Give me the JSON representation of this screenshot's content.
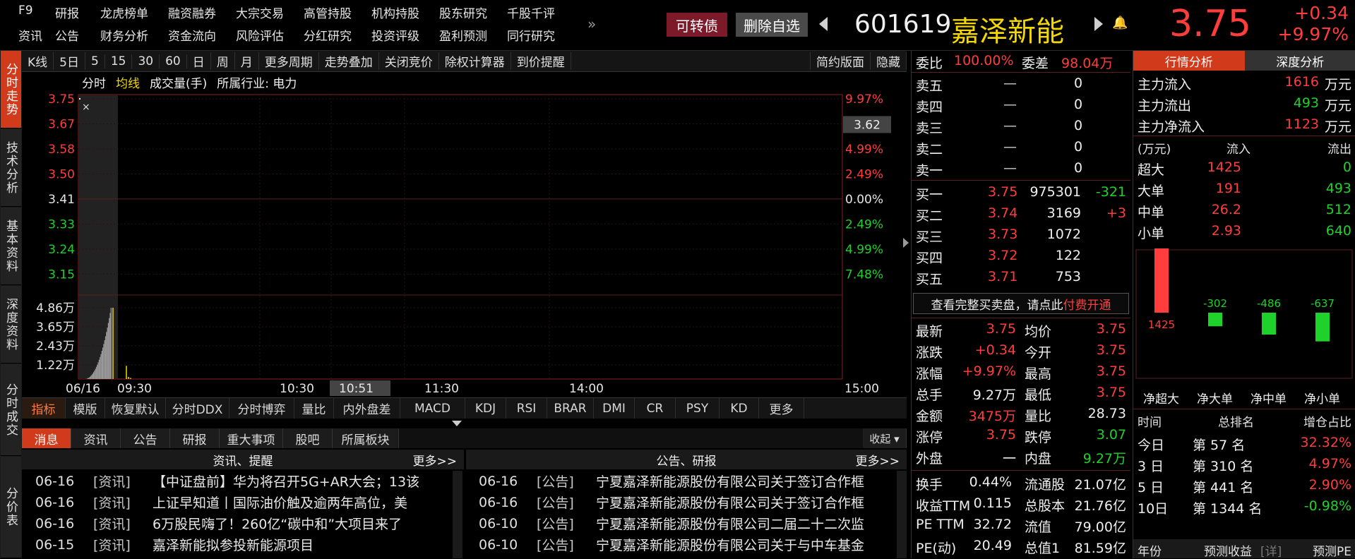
{
  "header": {
    "row1": [
      "F9",
      "研报",
      "龙虎榜单",
      "融资融券",
      "大宗交易",
      "高管持股",
      "机构持股",
      "股东研究",
      "千股千评"
    ],
    "row2": [
      "资讯",
      "公告",
      "财务分析",
      "资金流向",
      "风险评估",
      "分红研究",
      "投资评级",
      "盈利预测",
      "同行研究"
    ],
    "expand_glyph": "»",
    "convertible_btn": "可转债",
    "remove_fav_btn": "删除自选",
    "code": "601619",
    "name": "嘉泽新能",
    "price": "3.75",
    "change": "+0.34",
    "change_pct": "+9.97%"
  },
  "left_tabs": [
    "分时走势",
    "技术分析",
    "基本资料",
    "深度资料",
    "分时成交",
    "分价表"
  ],
  "chart_toolbar": {
    "items": [
      "K线",
      "5日",
      "5",
      "15",
      "30",
      "60",
      "日",
      "周",
      "月",
      "更多周期",
      "走势叠加",
      "关闭竞价",
      "除权计算器",
      "到价提醒"
    ],
    "simple_layout": "简约版面",
    "hide": "隐藏"
  },
  "chart_legend": {
    "fenshi": "分时",
    "junxian": "均线",
    "volume": "成交量(手)",
    "industry": "所属行业: 电力"
  },
  "chart_data": {
    "type": "line",
    "prev_close": 3.41,
    "price_ticks": [
      "3.75",
      "3.67",
      "3.58",
      "3.50",
      "3.41",
      "3.33",
      "3.24",
      "3.15"
    ],
    "pct_ticks": [
      "9.97%",
      "7.48%",
      "4.99%",
      "2.49%",
      "0.00%",
      "2.49%",
      "4.99%",
      "7.48%"
    ],
    "hover_price": "3.62",
    "vol_ticks": [
      "4.86万",
      "3.65万",
      "2.43万",
      "1.22万"
    ],
    "time_ticks": [
      "06/16",
      "09:30",
      "10:30",
      "10:51",
      "11:30",
      "14:00",
      "15:00"
    ],
    "price_series": [
      {
        "t": "09:30",
        "v": 3.75
      },
      {
        "t": "09:32",
        "v": 3.75
      }
    ],
    "volume_series": [
      {
        "t": "09:30",
        "v": 48600
      },
      {
        "t": "09:31",
        "v": 9000
      },
      {
        "t": "09:33",
        "v": 1500
      },
      {
        "t": "09:35",
        "v": 800
      }
    ]
  },
  "indicator_tabs": [
    "指标",
    "模版",
    "恢复默认",
    "分时DDX",
    "分时博弈",
    "量比",
    "内外盘差",
    "MACD",
    "KDJ",
    "RSI",
    "BRAR",
    "DMI",
    "CR",
    "PSY",
    "KD",
    "更多"
  ],
  "news_tabs": [
    "消息",
    "资讯",
    "公告",
    "研报",
    "重大事项",
    "股吧",
    "所属板块"
  ],
  "news_collapse": "收起",
  "news_left": {
    "title": "资讯、提醒",
    "more": "更多>>",
    "rows": [
      {
        "d": "06-16",
        "t": "[资讯]",
        "s": "【中证盘前】华为将召开5G+AR大会；13该"
      },
      {
        "d": "06-16",
        "t": "[资讯]",
        "s": "上证早知道丨国际油价触及逾两年高位，美"
      },
      {
        "d": "06-16",
        "t": "[资讯]",
        "s": "6万股民嗨了！260亿“碳中和”大项目来了"
      },
      {
        "d": "06-15",
        "t": "[资讯]",
        "s": "嘉泽新能拟参投新能源项目"
      }
    ]
  },
  "news_right": {
    "title": "公告、研报",
    "more": "更多>>",
    "rows": [
      {
        "d": "06-16",
        "t": "[公告]",
        "s": "宁夏嘉泽新能源股份有限公司关于签订合作框"
      },
      {
        "d": "06-16",
        "t": "[公告]",
        "s": "宁夏嘉泽新能源股份有限公司关于签订合作框"
      },
      {
        "d": "06-10",
        "t": "[公告]",
        "s": "宁夏嘉泽新能源股份有限公司二届二十二次监"
      },
      {
        "d": "06-10",
        "t": "[公告]",
        "s": "宁夏嘉泽新能源股份有限公司关于与中车基金"
      }
    ]
  },
  "orderbook": {
    "weibi_label": "委比",
    "weibi": "100.00%",
    "weicha_label": "委差",
    "weicha": "98.04万",
    "asks": [
      {
        "l": "卖五",
        "p": "—",
        "v": "0"
      },
      {
        "l": "卖四",
        "p": "—",
        "v": "0"
      },
      {
        "l": "卖三",
        "p": "—",
        "v": "0"
      },
      {
        "l": "卖二",
        "p": "—",
        "v": "0"
      },
      {
        "l": "卖一",
        "p": "—",
        "v": "0"
      }
    ],
    "bids": [
      {
        "l": "买一",
        "p": "3.75",
        "v": "975301",
        "c": "-321"
      },
      {
        "l": "买二",
        "p": "3.74",
        "v": "3169",
        "c": "+3"
      },
      {
        "l": "买三",
        "p": "3.73",
        "v": "1072",
        "c": ""
      },
      {
        "l": "买四",
        "p": "3.72",
        "v": "122",
        "c": ""
      },
      {
        "l": "买五",
        "p": "3.71",
        "v": "753",
        "c": ""
      }
    ],
    "full_book_text": "查看完整买卖盘，请点此",
    "full_book_link": "付费开通",
    "stats": [
      {
        "l": "最新",
        "v": "3.75",
        "l2": "均价",
        "v2": "3.75"
      },
      {
        "l": "涨跌",
        "v": "+0.34",
        "l2": "今开",
        "v2": "3.75"
      },
      {
        "l": "涨幅",
        "v": "+9.97%",
        "l2": "最高",
        "v2": "3.75"
      },
      {
        "l": "总手",
        "v": "9.27万",
        "l2": "最低",
        "v2": "3.75"
      },
      {
        "l": "金额",
        "v": "3475万",
        "l2": "量比",
        "v2": "28.73"
      },
      {
        "l": "涨停",
        "v": "3.75",
        "l2": "跌停",
        "v2": "3.07"
      },
      {
        "l": "外盘",
        "v": "一",
        "l2": "内盘",
        "v2": "9.27万"
      }
    ],
    "stats2": [
      {
        "l": "换手",
        "v": "0.44%",
        "l2": "流通股",
        "v2": "21.07亿"
      },
      {
        "l": "收益TTM",
        "v": "0.115",
        "l2": "总股本",
        "v2": "21.76亿"
      },
      {
        "l": "PE TTM",
        "v": "32.72",
        "l2": "流值",
        "v2": "79.00亿"
      },
      {
        "l": "PE(动)",
        "v": "20.49",
        "l2": "总值1",
        "v2": "81.59亿"
      }
    ]
  },
  "right_panel": {
    "tabs": [
      "行情分析",
      "深度分析"
    ],
    "flow": [
      {
        "l": "主力流入",
        "v": "1616",
        "u": "万元"
      },
      {
        "l": "主力流出",
        "v": "493",
        "u": "万元"
      },
      {
        "l": "主力净流入",
        "v": "1123",
        "u": "万元"
      }
    ],
    "table_head": [
      "(万元)",
      "流入",
      "流出"
    ],
    "table": [
      {
        "l": "超大",
        "in": "1425",
        "out": "0"
      },
      {
        "l": "大单",
        "in": "191",
        "out": "493"
      },
      {
        "l": "中单",
        "in": "26.2",
        "out": "512"
      },
      {
        "l": "小单",
        "in": "2.93",
        "out": "640"
      }
    ],
    "bar_labels": [
      "1425",
      "-302",
      "-486",
      "-637"
    ],
    "bar_values": [
      1425,
      -302,
      -486,
      -637
    ],
    "bar_cats": [
      "净超大",
      "净大单",
      "净中单",
      "净小单"
    ],
    "rank_head": [
      "时间",
      "总排名",
      "增仓占比"
    ],
    "ranks": [
      {
        "t": "今日",
        "r": "第 57 名",
        "p": "32.32%"
      },
      {
        "t": "3 日",
        "r": "第 310 名",
        "p": "4.97%"
      },
      {
        "t": "5 日",
        "r": "第 441 名",
        "p": "2.90%"
      },
      {
        "t": "10日",
        "r": "第 1344 名",
        "p": "-0.98%"
      }
    ],
    "forecast_head": [
      "年份",
      "预测收益",
      "[详]",
      "预测PE"
    ]
  },
  "colors": {
    "up": "#ff3d3d",
    "down": "#1fd12b",
    "accent": "#d23a1c",
    "yellow": "#f5d800"
  }
}
